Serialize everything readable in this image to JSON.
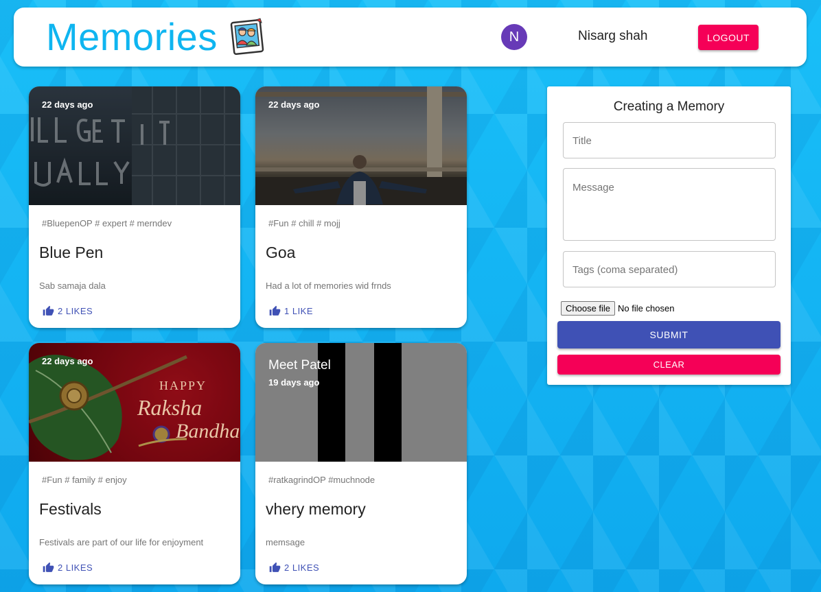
{
  "header": {
    "title": "Memories",
    "logo_icon": "family-photo-icon",
    "avatar_initial": "N",
    "user_name": "Nisarg shah",
    "logout_label": "LOGOUT",
    "colors": {
      "brand": "#0fb5f0",
      "avatar": "#673ab7",
      "secondary": "#f50057",
      "primary": "#3f51b5"
    }
  },
  "posts": [
    {
      "author": "",
      "time": "22 days ago",
      "tags": "#BluepenOP # expert # merndev",
      "title": "Blue Pen",
      "message": "Sab samaja dala",
      "likes": "2 LIKES",
      "image": "neon-sign-photo"
    },
    {
      "author": "",
      "time": "22 days ago",
      "tags": "#Fun # chill # mojj",
      "title": "Goa",
      "message": "Had a lot of memories wid frnds",
      "likes": "1 LIKE",
      "image": "beach-person-photo"
    },
    {
      "author": "",
      "time": "22 days ago",
      "tags": "#Fun # family # enjoy",
      "title": "Festivals",
      "message": "Festivals are part of our life for enjoyment",
      "likes": "2 LIKES",
      "image": "raksha-bandhan-photo"
    },
    {
      "author": "Meet Patel",
      "time": "19 days ago",
      "tags": "#ratkagrindOP #muchnode",
      "title": "vhery memory",
      "message": "memsage",
      "likes": "2 LIKES",
      "image": "gray-black-stripes"
    }
  ],
  "form": {
    "heading": "Creating a Memory",
    "title_placeholder": "Title",
    "message_placeholder": "Message",
    "tags_placeholder": "Tags (coma separated)",
    "file_button": "Choose file",
    "file_status": "No file chosen",
    "submit_label": "SUBMIT",
    "clear_label": "CLEAR"
  }
}
